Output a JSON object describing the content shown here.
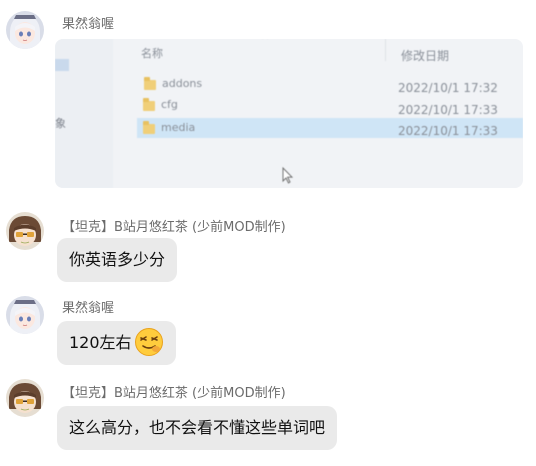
{
  "messages": [
    {
      "sender": "果然翁喔",
      "type": "image",
      "image": {
        "columns": {
          "name": "名称",
          "modified": "修改日期"
        },
        "rows": [
          {
            "name": "addons",
            "date": "2022/10/1 17:32"
          },
          {
            "name": "cfg",
            "date": "2022/10/1 17:33"
          },
          {
            "name": "media",
            "date": "2022/10/1 17:33"
          }
        ],
        "side_label": "象"
      }
    },
    {
      "sender": "【坦克】B站月悠红茶 (少前MOD制作)",
      "type": "text",
      "text": "你英语多少分"
    },
    {
      "sender": "果然翁喔",
      "type": "text",
      "text": "120左右",
      "emoji": "hiccup-face-emoji"
    },
    {
      "sender": "【坦克】B站月悠红茶 (少前MOD制作)",
      "type": "text",
      "text": "这么高分，也不会看不懂这些单词吧"
    }
  ],
  "colors": {
    "bubble": "#eaeaea",
    "sender_text": "#6b6b6b",
    "selected_row": "#cfe5f6"
  },
  "icons": {
    "avatar_a": "anime-girl-white-hair-avatar",
    "avatar_b": "anime-tank-character-avatar"
  }
}
